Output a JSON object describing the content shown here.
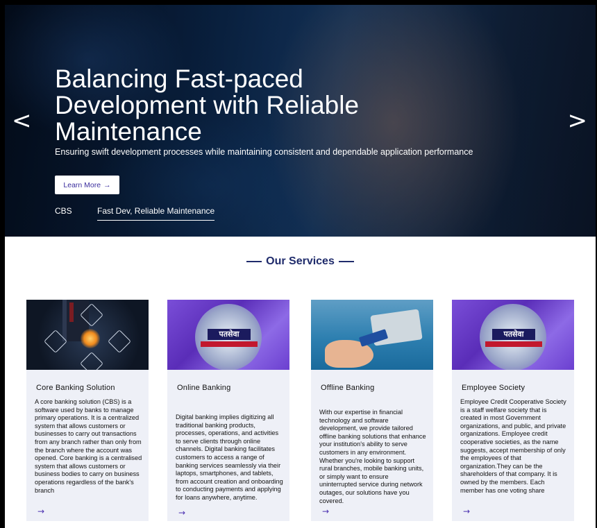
{
  "hero": {
    "title": "Balancing Fast-paced Development with Reliable Maintenance",
    "subtitle": "Ensuring swift development processes while maintaining consistent and dependable application performance",
    "button_label": "Learn More",
    "button_arrow": "→",
    "prev_arrow": "<",
    "next_arrow": ">",
    "tabs": [
      "CBS",
      "Fast Dev, Reliable Maintenance"
    ]
  },
  "services": {
    "heading": "Our Services",
    "cards": [
      {
        "title": "Core Banking Solution",
        "body": "A core banking solution (CBS) is a software used by banks to manage primary operations. It is a centralized system that allows customers or businesses to carry out transactions from any branch rather than only from the branch where the account was opened. Core banking is a  centralised system that allows customers or business bodies to carry on business operations regardless of the bank's branch",
        "arrow": "→"
      },
      {
        "title": "Online Banking",
        "body": "Digital banking implies digitizing all traditional banking products, processes, operations, and activities to serve clients through online channels. Digital banking facilitates customers to access a range of banking services seamlessly via their laptops, smartphones, and tablets, from account creation and onboarding to conducting payments and applying for loans anywhere, anytime.",
        "arrow": "→",
        "image_text": "पतसेवा"
      },
      {
        "title": "Offline Banking",
        "body": "With our expertise in financial technology and software development, we provide tailored offline banking solutions that enhance your institution's ability to serve customers in any environment. Whether you're looking to support rural branches, mobile banking units, or simply want to ensure uninterrupted service during network outages, our solutions have you covered.",
        "arrow": "→"
      },
      {
        "title": "Employee Society",
        "body": "Employee Credit Cooperative Society is a staff welfare society that is created in most Government organizations, and public, and private organizations. Employee credit cooperative societies, as the name suggests, accept membership of only the employees of that organization.They can be the shareholders of that company. It is owned by the members. Each member has one voting share",
        "arrow": "→",
        "image_text": "पतसेवा"
      }
    ]
  },
  "colors": {
    "accent": "#3b2e9e",
    "heading": "#1f2b6b",
    "card_bg": "#eef0f7"
  }
}
